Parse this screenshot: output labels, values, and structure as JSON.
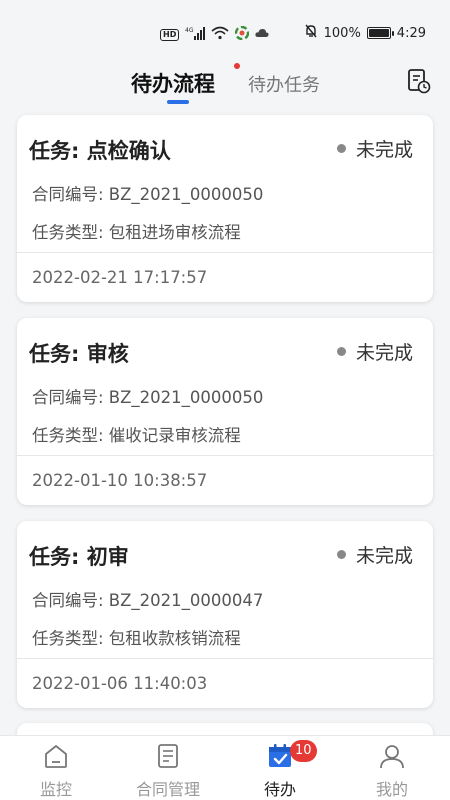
{
  "status_bar": {
    "hd": "HD",
    "signal": "4G",
    "battery": "100%",
    "battery_level": 1.0,
    "time": "4:29"
  },
  "header": {
    "tabs": [
      {
        "label": "待办流程",
        "active": true,
        "has_dot": true
      },
      {
        "label": "待办任务",
        "active": false
      }
    ],
    "action_icon": "document-clock-icon"
  },
  "tasks": [
    {
      "title": "任务: 点检确认",
      "status": "未完成",
      "contract": "合同编号: BZ_2021_0000050",
      "type": "任务类型: 包租进场审核流程",
      "date": "2022-02-21 17:17:57"
    },
    {
      "title": "任务: 审核",
      "status": "未完成",
      "contract": "合同编号: BZ_2021_0000050",
      "type": "任务类型: 催收记录审核流程",
      "date": "2022-01-10 10:38:57"
    },
    {
      "title": "任务: 初审",
      "status": "未完成",
      "contract": "合同编号: BZ_2021_0000047",
      "type": "任务类型: 包租收款核销流程",
      "date": "2022-01-06 11:40:03"
    }
  ],
  "bottom_nav": [
    {
      "label": "监控",
      "icon": "home-icon",
      "active": false
    },
    {
      "label": "合同管理",
      "icon": "contract-icon",
      "active": false
    },
    {
      "label": "待办",
      "icon": "calendar-check-icon",
      "active": true,
      "badge": "10"
    },
    {
      "label": "我的",
      "icon": "user-icon",
      "active": false
    }
  ],
  "colors": {
    "accent": "#2b6fe6",
    "badge": "#e53935",
    "status_dot": "#888888"
  }
}
